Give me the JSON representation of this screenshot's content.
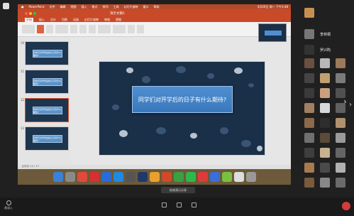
{
  "mac_menubar": {
    "items": [
      "PowerPoint",
      "文件",
      "编辑",
      "视图",
      "插入",
      "格式",
      "排列",
      "工具",
      "幻灯片放映",
      "窗口",
      "帮助"
    ],
    "clock": "4月20日 周一 下午3:48"
  },
  "ppt": {
    "window_title": "演示文稿1",
    "tabs": [
      "开始",
      "插入",
      "设计",
      "切换",
      "动画",
      "幻灯片放映",
      "审阅",
      "视图"
    ],
    "active_tab": "开始",
    "status_text": "幻灯片 12 / 17",
    "thumb_numbers": [
      "10",
      "11",
      "12",
      "13"
    ],
    "thumb_caption": "同学们对开学后的日子有什么期待?"
  },
  "slide": {
    "question": "同学们对开学后的日子有什么期待?"
  },
  "meeting": {
    "share_label": "结束演示分享",
    "participants": [
      {
        "name": "李林桐"
      },
      {
        "name": "罗兴昀"
      }
    ],
    "bottom_left_label": "邀请入"
  },
  "colors": {
    "ppt_accent": "#c84a28",
    "slide_bg": "#1a2f48",
    "question_box": "#3a78bd",
    "leave_button": "#d63b3b"
  }
}
